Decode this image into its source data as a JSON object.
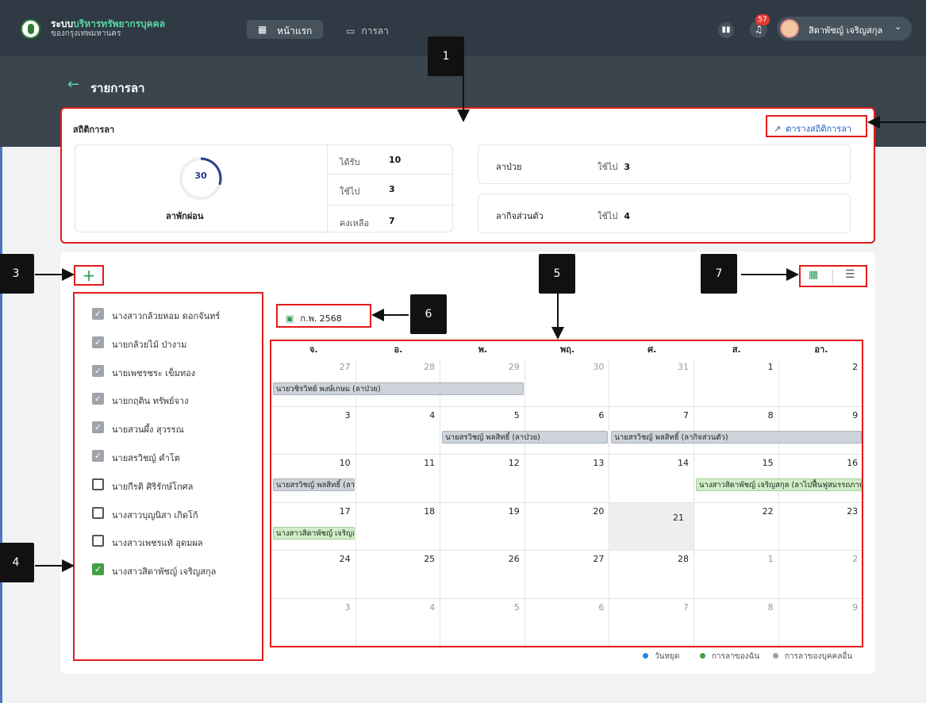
{
  "app": {
    "brand_prefix": "ระบบ",
    "brand_highlight": "บริหารทรัพยากรบุคคล",
    "brand_sub": "ของกรุงเทพมหานคร",
    "nav_home": "หน้าแรก",
    "nav_leave": "การลา",
    "notification_count": "57",
    "user_name": "สิดาพัชญ์ เจริญสกุล"
  },
  "page": {
    "title": "รายการลา"
  },
  "stats": {
    "title": "สถิติการลา",
    "chart_link": "ตารางสถิติการลา",
    "vacation": {
      "days": "30",
      "label": "ลาพักผ่อน",
      "received_label": "ได้รับ",
      "received": "10",
      "used_label": "ใช้ไป",
      "used": "3",
      "remaining_label": "คงเหลือ",
      "remaining": "7",
      "used_fraction": 0.3
    },
    "sick": {
      "label": "ลาป่วย",
      "used_label": "ใช้ไป",
      "used": "3"
    },
    "personal": {
      "label": "ลากิจส่วนตัว",
      "used_label": "ใช้ไป",
      "used": "4"
    }
  },
  "month_label": "ก.พ. 2568",
  "weekdays": [
    "จ.",
    "อ.",
    "พ.",
    "พฤ.",
    "ศ.",
    "ส.",
    "อา."
  ],
  "weeks": [
    [
      {
        "d": "27",
        "m": 1
      },
      {
        "d": "28",
        "m": 1
      },
      {
        "d": "29",
        "m": 1
      },
      {
        "d": "30",
        "m": 1
      },
      {
        "d": "31",
        "m": 1
      },
      {
        "d": "1",
        "m": 0
      },
      {
        "d": "2",
        "m": 0
      }
    ],
    [
      {
        "d": "3",
        "m": 0
      },
      {
        "d": "4",
        "m": 0
      },
      {
        "d": "5",
        "m": 0
      },
      {
        "d": "6",
        "m": 0
      },
      {
        "d": "7",
        "m": 0
      },
      {
        "d": "8",
        "m": 0
      },
      {
        "d": "9",
        "m": 0
      }
    ],
    [
      {
        "d": "10",
        "m": 0
      },
      {
        "d": "11",
        "m": 0
      },
      {
        "d": "12",
        "m": 0
      },
      {
        "d": "13",
        "m": 0
      },
      {
        "d": "14",
        "m": 0
      },
      {
        "d": "15",
        "m": 0
      },
      {
        "d": "16",
        "m": 0
      }
    ],
    [
      {
        "d": "17",
        "m": 0
      },
      {
        "d": "18",
        "m": 0
      },
      {
        "d": "19",
        "m": 0
      },
      {
        "d": "20",
        "m": 0
      },
      {
        "d": "21",
        "m": 0,
        "today": 1
      },
      {
        "d": "22",
        "m": 0
      },
      {
        "d": "23",
        "m": 0
      }
    ],
    [
      {
        "d": "24",
        "m": 0
      },
      {
        "d": "25",
        "m": 0
      },
      {
        "d": "26",
        "m": 0
      },
      {
        "d": "27",
        "m": 0
      },
      {
        "d": "28",
        "m": 0
      },
      {
        "d": "1",
        "m": 1
      },
      {
        "d": "2",
        "m": 1
      }
    ],
    [
      {
        "d": "3",
        "m": 1
      },
      {
        "d": "4",
        "m": 1
      },
      {
        "d": "5",
        "m": 1
      },
      {
        "d": "6",
        "m": 1
      },
      {
        "d": "7",
        "m": 1
      },
      {
        "d": "8",
        "m": 1
      },
      {
        "d": "9",
        "m": 1
      }
    ]
  ],
  "events": [
    {
      "text": "นายวชิรวิทย์ พงษ์เกษม (ลาป่วย)",
      "week": 0,
      "start": 0,
      "span": 3,
      "kind": "other"
    },
    {
      "text": "นายสรวิชญ์ พลสิทธิ์ (ลาป่วย)",
      "week": 1,
      "start": 2,
      "span": 2,
      "kind": "other"
    },
    {
      "text": "นายสรวิชญ์ พลสิทธิ์ (ลากิจส่วนตัว)",
      "week": 1,
      "start": 4,
      "span": 3,
      "kind": "other"
    },
    {
      "text": "นายสรวิชญ์ พลสิทธิ์ (ลากิจส่วนตัว)",
      "week": 2,
      "start": 0,
      "span": 1,
      "kind": "other"
    },
    {
      "text": "นางสาวสิดาพัชญ์ เจริญสกุล (ลาไปฟื้นฟูสมรรถภาพ)",
      "week": 2,
      "start": 5,
      "span": 2,
      "kind": "mine"
    },
    {
      "text": "นางสาวสิดาพัชญ์ เจริญสกุล",
      "week": 3,
      "start": 0,
      "span": 1,
      "kind": "mine"
    }
  ],
  "employees": [
    {
      "name": "นางสาวกล้วยหอม ดอกจันทร์",
      "state": "checked"
    },
    {
      "name": "นายกล้วยไม้ ป่างาม",
      "state": "checked"
    },
    {
      "name": "นายเพชรชระ เข็มทอง",
      "state": "checked"
    },
    {
      "name": "นายกฤติน ทรัพย์จาง",
      "state": "checked"
    },
    {
      "name": "นายสวนผึ้ง สุวรรณ",
      "state": "checked"
    },
    {
      "name": "นายสรวิชญ์ คำโต",
      "state": "checked"
    },
    {
      "name": "นายกีรติ ศิริรักษ์โกศล",
      "state": "unchecked"
    },
    {
      "name": "นางสาวบุญนิสา เกิดโก้",
      "state": "unchecked"
    },
    {
      "name": "นางสาวเพชรแท้ อุดมผล",
      "state": "unchecked"
    },
    {
      "name": "นางสาวสิดาพัชญ์ เจริญสกุล",
      "state": "mine"
    }
  ],
  "legend": [
    {
      "label": "วันหยุด",
      "color": "#1e88e5"
    },
    {
      "label": "การลาของฉัน",
      "color": "#43a047"
    },
    {
      "label": "การลาของบุคคลอื่น",
      "color": "#9e9e9e"
    }
  ],
  "callouts": [
    "1",
    "3",
    "4",
    "5",
    "6",
    "7"
  ],
  "colors": {
    "annotation_red": "#e21b1b",
    "accent_green": "#2e9a5a",
    "topbar": "#2f3a44"
  }
}
